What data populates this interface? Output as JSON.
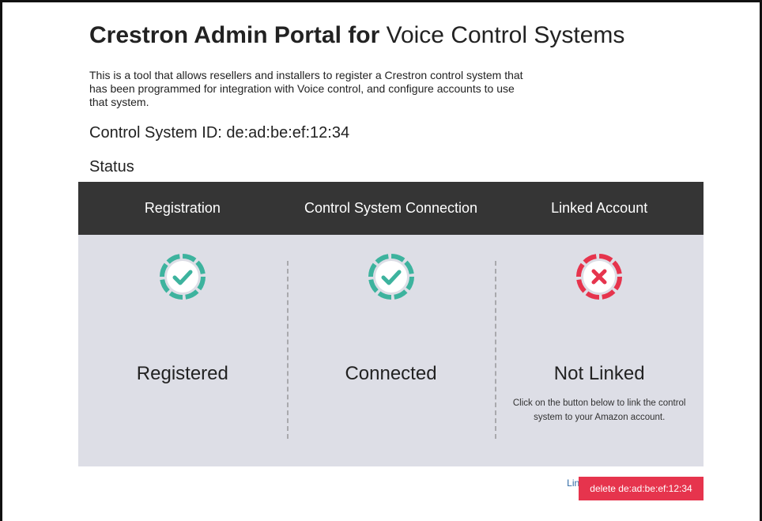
{
  "page": {
    "title_bold": "Crestron Admin Portal for",
    "title_rest": " Voice Control Systems",
    "description": "This is a tool that allows resellers and installers to register a Crestron control system that has been programmed for integration with Voice control, and configure accounts to use that system.",
    "control_system_id_label": "Control System ID: de:ad:be:ef:12:34",
    "status_heading": "Status"
  },
  "status_panel": {
    "columns": [
      {
        "header": "Registration",
        "state": "Registered",
        "icon": "check-circle-icon",
        "color": "#3db39e"
      },
      {
        "header": "Control System Connection",
        "state": "Connected",
        "icon": "check-circle-icon",
        "color": "#3db39e"
      },
      {
        "header": "Linked Account",
        "state": "Not Linked",
        "icon": "x-circle-icon",
        "color": "#e6344d",
        "help_text": "Click on the button below to link the control system to your Amazon account.",
        "link_label": "Link to Amazon"
      }
    ],
    "header_bg": "#353535",
    "body_bg": "#dddee6"
  },
  "delete_button": {
    "label": "delete de:ad:be:ef:12:34",
    "color": "#e6344d"
  }
}
